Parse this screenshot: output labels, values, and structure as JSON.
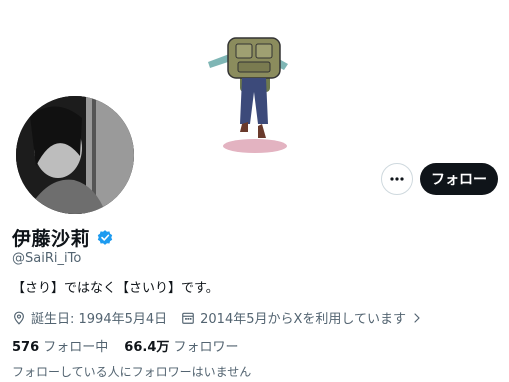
{
  "profile": {
    "display_name": "伊藤沙莉",
    "handle": "@SaiRi_iTo",
    "bio": "【さり】ではなく【さいり】です。",
    "birthday": "誕生日: 1994年5月4日",
    "joined": "2014年5月からXを利用しています",
    "following_count": "576",
    "following_label": "フォロー中",
    "followers_count": "66.4万",
    "followers_label": "フォロワー",
    "followed_by_note": "フォローしている人にフォロワーはいません"
  },
  "actions": {
    "more_label": "•••",
    "follow_label": "フォロー"
  },
  "colors": {
    "verified": "#1d9bf0",
    "primary_button": "#0f1419",
    "secondary_text": "#536471"
  },
  "icons": {
    "verified": "verified-badge-icon",
    "birthday": "location-pin-icon",
    "joined": "calendar-icon",
    "joined_more": "chevron-right-icon",
    "more": "more-dots-icon"
  }
}
